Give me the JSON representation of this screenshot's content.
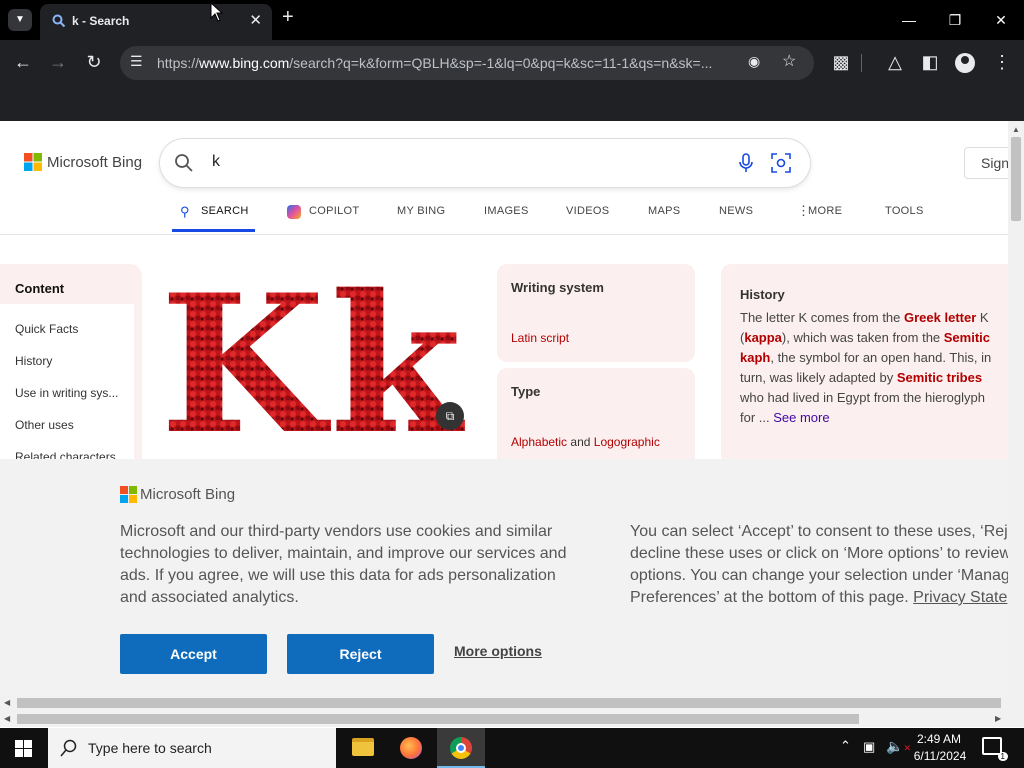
{
  "tab": {
    "title": "k - Search",
    "favicon": "search-icon"
  },
  "toolbar": {
    "url_prefix": "https://",
    "url_host": "www.bing.com",
    "url_rest": "/search?q=k&form=QBLH&sp=-1&lq=0&pq=k&sc=11-1&qs=n&sk=..."
  },
  "bing": {
    "logo_text": "Microsoft Bing",
    "query": "k",
    "signin_label": "Sign",
    "tabs": [
      "SEARCH",
      "COPILOT",
      "MY BING",
      "IMAGES",
      "VIDEOS",
      "MAPS",
      "NEWS",
      "MORE",
      "TOOLS"
    ]
  },
  "sidebar": {
    "heading": "Content",
    "items": [
      "Quick Facts",
      "History",
      "Use in writing sys...",
      "Other uses",
      "Related characters"
    ]
  },
  "writing": {
    "heading": "Writing system",
    "value": "Latin script",
    "type_heading": "Type",
    "type_a": "Alphabetic",
    "type_and": "and",
    "type_b": "Logographic"
  },
  "history": {
    "heading": "History",
    "p1": "The letter K comes from the ",
    "l1": "Greek letter",
    "p2": " K",
    "p3": "(",
    "l2": "kappa",
    "p4": "), which was taken from the ",
    "l3": "Semitic",
    "l4": "kaph",
    "p5": ", the symbol for an open hand. This, in",
    "p6": "turn, was likely adapted by ",
    "l5": "Semitic tribes",
    "p7": "who had lived in Egypt from the hieroglyph",
    "p8": "for ... ",
    "see_more": "See more"
  },
  "cookie": {
    "logo_text": "Microsoft Bing",
    "left_lines": [
      "Microsoft and our third-party vendors use cookies and similar",
      "technologies to deliver, maintain, and improve our services and",
      "ads. If you agree, we will use this data for ads personalization",
      "and associated analytics."
    ],
    "right_lines": [
      "You can select ‘Accept’ to consent to these uses, ‘Rej",
      "decline these uses or click on ‘More options’ to review",
      "options. You can change your selection under ‘Manag",
      "Preferences’ at the bottom of this page."
    ],
    "privacy_link": "Privacy State",
    "accept": "Accept",
    "reject": "Reject",
    "more": "More options"
  },
  "taskbar": {
    "search_placeholder": "Type here to search",
    "time": "2:49 AM",
    "date": "6/11/2024",
    "notif_count": "1"
  },
  "colors": {
    "accent": "#174ae4",
    "bing_red": "#b20000",
    "button_blue": "#0f6cbd"
  }
}
